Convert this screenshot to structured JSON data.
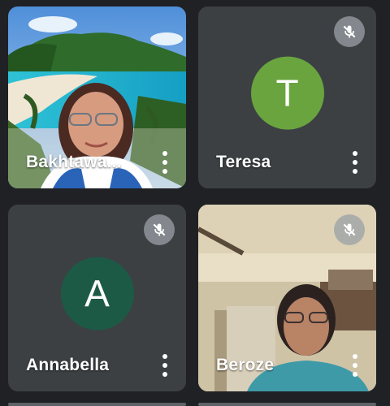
{
  "participants": [
    {
      "name": "Bakhtawa...",
      "type": "video",
      "muted": false
    },
    {
      "name": "Teresa",
      "type": "avatar",
      "initial": "T",
      "avatar_color": "#6aa43f",
      "muted": true
    },
    {
      "name": "Annabella",
      "type": "avatar",
      "initial": "A",
      "avatar_color": "#1d5a45",
      "muted": true
    },
    {
      "name": "Beroze",
      "type": "video",
      "muted": true
    }
  ],
  "colors": {
    "background": "#202124",
    "tile": "#3c4043",
    "mute_badge": "#9aa0a6"
  },
  "icons": {
    "mute": "mic-off-icon",
    "more": "more-vert-icon"
  }
}
